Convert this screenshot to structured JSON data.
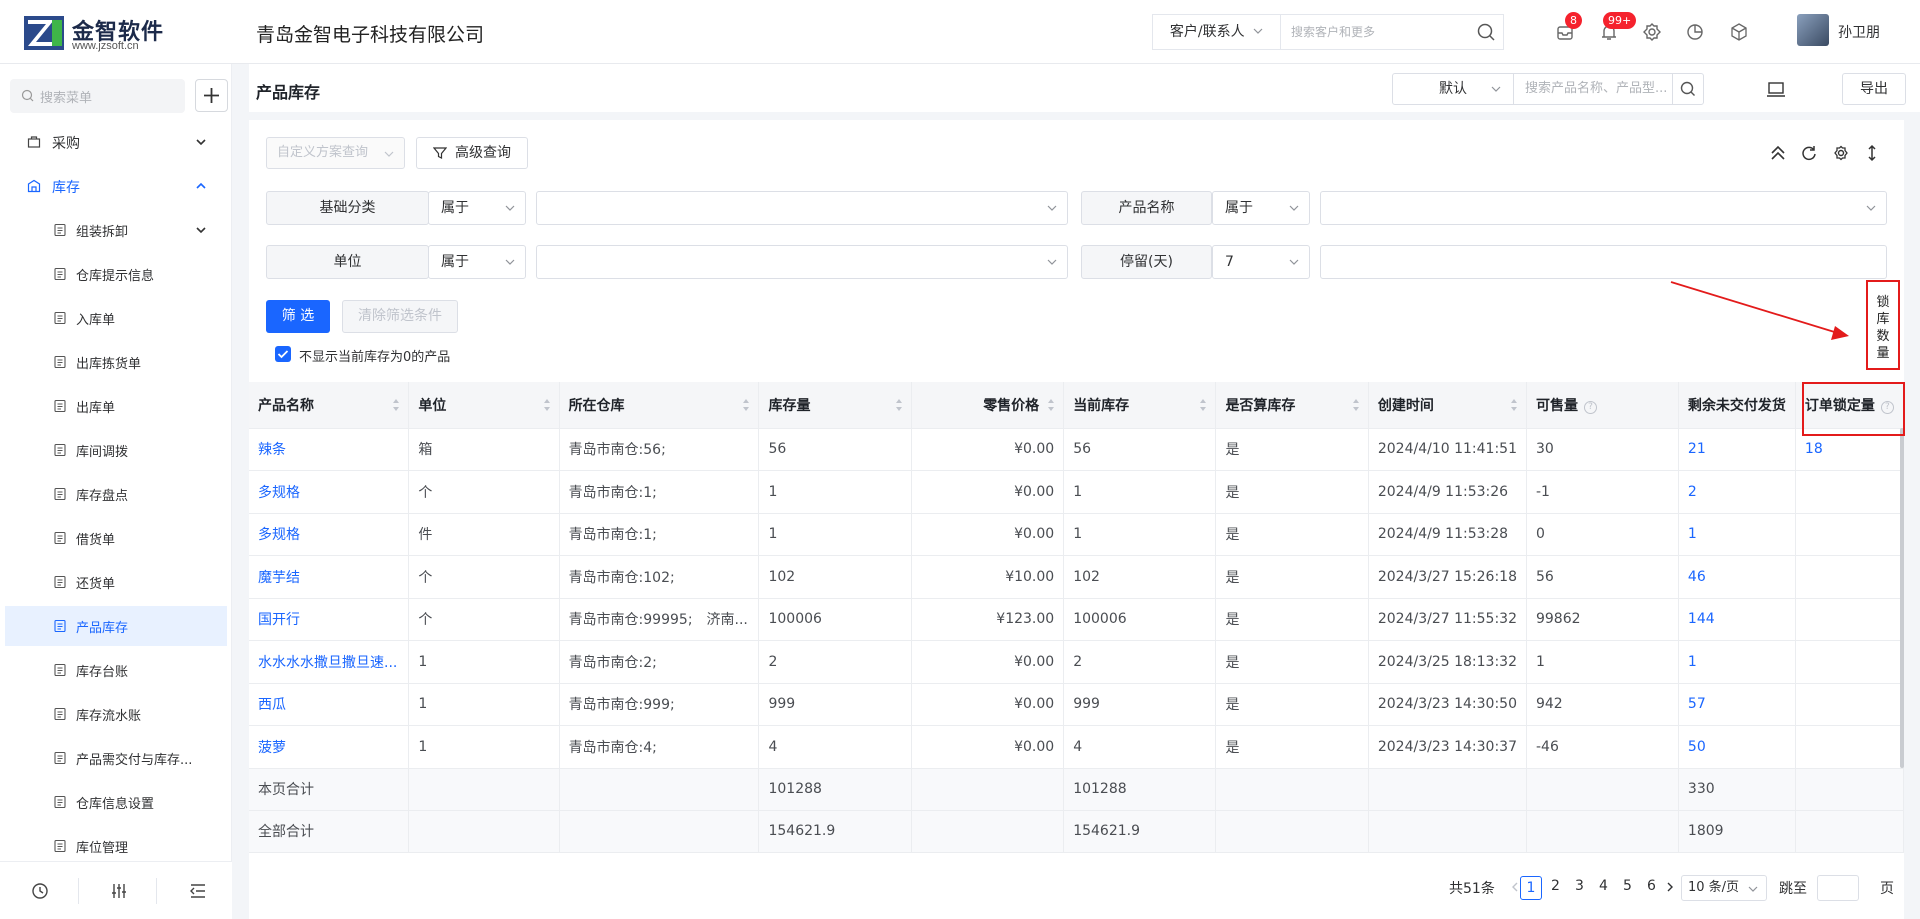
{
  "header": {
    "logo_name": "金智软件",
    "logo_url": "www.jzsoft.cn",
    "company": "青岛金智电子科技有限公司",
    "search_type": "客户/联系人",
    "search_placeholder": "搜索客户和更多",
    "mail_badge": "8",
    "bell_badge": "99+",
    "user_name": "孙卫朋"
  },
  "sidebar": {
    "search_placeholder": "搜索菜单",
    "groups": [
      {
        "label": "采购"
      },
      {
        "label": "库存"
      }
    ],
    "items": [
      {
        "label": "组装拆卸",
        "icon": "assemble-icon"
      },
      {
        "label": "仓库提示信息",
        "icon": "doc-icon"
      },
      {
        "label": "入库单",
        "icon": "inbound-icon"
      },
      {
        "label": "出库拣货单",
        "icon": "pick-icon"
      },
      {
        "label": "出库单",
        "icon": "outbound-icon"
      },
      {
        "label": "库间调拨",
        "icon": "transfer-icon"
      },
      {
        "label": "库存盘点",
        "icon": "stocktake-icon"
      },
      {
        "label": "借货单",
        "icon": "borrow-icon"
      },
      {
        "label": "还货单",
        "icon": "return-icon"
      },
      {
        "label": "产品库存",
        "icon": "product-stock-icon"
      },
      {
        "label": "库存台账",
        "icon": "ledger-icon"
      },
      {
        "label": "库存流水账",
        "icon": "journal-icon"
      },
      {
        "label": "产品需交付与库存...",
        "icon": "delivery-icon"
      },
      {
        "label": "仓库信息设置",
        "icon": "settings-icon"
      },
      {
        "label": "库位管理",
        "icon": "location-icon"
      }
    ]
  },
  "page": {
    "title": "产品库存",
    "view_select": "默认",
    "search_placeholder": "搜索产品名称、产品型...",
    "export_label": "导出"
  },
  "filters": {
    "scheme_placeholder": "自定义方案查询",
    "advanced_label": "高级查询",
    "row1": {
      "field1": "基础分类",
      "op1": "属于",
      "value1": "",
      "field2": "产品名称",
      "op2": "属于",
      "value2": ""
    },
    "row2": {
      "field1": "单位",
      "op1": "属于",
      "value1": "",
      "field2": "停留(天)",
      "op2": "7",
      "value2": ""
    },
    "filter_btn": "筛 选",
    "clear_btn": "清除筛选条件",
    "hide_zero_label": "不显示当前库存为0的产品",
    "hide_zero_checked": true
  },
  "annotation": {
    "vertical_label": [
      "锁",
      "库",
      "数",
      "量"
    ]
  },
  "table": {
    "columns": [
      "产品名称",
      "单位",
      "所在仓库",
      "库存量",
      "零售价格",
      "当前库存",
      "是否算库存",
      "创建时间",
      "可售量",
      "剩余未交付发货",
      "订单锁定量"
    ],
    "rows": [
      [
        "辣条",
        "箱",
        "青岛市南仓:56;",
        "56",
        "¥0.00",
        "56",
        "是",
        "2024/4/10 11:41:51",
        "30",
        "21",
        "18"
      ],
      [
        "多规格",
        "个",
        "青岛市南仓:1;",
        "1",
        "¥0.00",
        "1",
        "是",
        "2024/4/9 11:53:26",
        "-1",
        "2",
        ""
      ],
      [
        "多规格",
        "件",
        "青岛市南仓:1;",
        "1",
        "¥0.00",
        "1",
        "是",
        "2024/4/9 11:53:28",
        "0",
        "1",
        ""
      ],
      [
        "魔芋结",
        "个",
        "青岛市南仓:102;",
        "102",
        "¥10.00",
        "102",
        "是",
        "2024/3/27 15:26:18",
        "56",
        "46",
        ""
      ],
      [
        "国开行",
        "个",
        "青岛市南仓:99995;　济南...",
        "100006",
        "¥123.00",
        "100006",
        "是",
        "2024/3/27 11:55:32",
        "99862",
        "144",
        ""
      ],
      [
        "水水水水撒旦撒旦速...",
        "1",
        "青岛市南仓:2;",
        "2",
        "¥0.00",
        "2",
        "是",
        "2024/3/25 18:13:32",
        "1",
        "1",
        ""
      ],
      [
        "西瓜",
        "1",
        "青岛市南仓:999;",
        "999",
        "¥0.00",
        "999",
        "是",
        "2024/3/23 14:30:50",
        "942",
        "57",
        ""
      ],
      [
        "菠萝",
        "1",
        "青岛市南仓:4;",
        "4",
        "¥0.00",
        "4",
        "是",
        "2024/3/23 14:30:37",
        "-46",
        "50",
        ""
      ]
    ],
    "summary": [
      [
        "本页合计",
        "",
        "",
        "101288",
        "",
        "101288",
        "",
        "",
        "",
        "330",
        ""
      ],
      [
        "全部合计",
        "",
        "",
        "154621.9",
        "",
        "154621.9",
        "",
        "",
        "",
        "1809",
        ""
      ]
    ]
  },
  "pagination": {
    "total": "共51条",
    "pages": [
      "1",
      "2",
      "3",
      "4",
      "5",
      "6"
    ],
    "current": "1",
    "page_size": "10 条/页",
    "jump_label": "跳至",
    "page_suffix": "页"
  },
  "colors": {
    "accent": "#1a66ff",
    "annotation": "#e31b1b"
  }
}
